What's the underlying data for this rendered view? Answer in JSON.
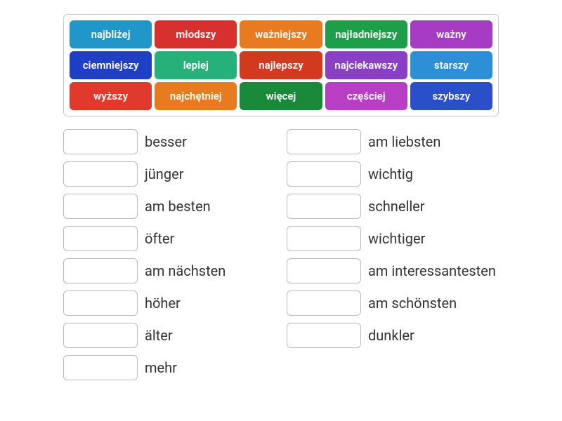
{
  "word_bank": [
    {
      "label": "najbliżej",
      "color": "#2196c9"
    },
    {
      "label": "młodszy",
      "color": "#d82f2f"
    },
    {
      "label": "ważniejszy",
      "color": "#e87a1f"
    },
    {
      "label": "najładniejszy",
      "color": "#1f9e4a"
    },
    {
      "label": "ważny",
      "color": "#a63cc4"
    },
    {
      "label": "ciemniejszy",
      "color": "#1f3fc4"
    },
    {
      "label": "lepiej",
      "color": "#26b07a"
    },
    {
      "label": "najlepszy",
      "color": "#d13a1f"
    },
    {
      "label": "najciekawszy",
      "color": "#8b3fc4"
    },
    {
      "label": "starszy",
      "color": "#2e8fd6"
    },
    {
      "label": "wyższy",
      "color": "#e0392e"
    },
    {
      "label": "najchętniej",
      "color": "#e87a1f"
    },
    {
      "label": "więcej",
      "color": "#1a8a3a"
    },
    {
      "label": "częściej",
      "color": "#b83fc4"
    },
    {
      "label": "szybszy",
      "color": "#2a4fc9"
    }
  ],
  "answers_left": [
    {
      "label": "besser"
    },
    {
      "label": "jünger"
    },
    {
      "label": "am besten"
    },
    {
      "label": "öfter"
    },
    {
      "label": "am nächsten"
    },
    {
      "label": "höher"
    },
    {
      "label": "älter"
    },
    {
      "label": "mehr"
    }
  ],
  "answers_right": [
    {
      "label": "am liebsten"
    },
    {
      "label": "wichtig"
    },
    {
      "label": "schneller"
    },
    {
      "label": "wichtiger"
    },
    {
      "label": "am interessantesten"
    },
    {
      "label": "am schönsten"
    },
    {
      "label": "dunkler"
    }
  ]
}
